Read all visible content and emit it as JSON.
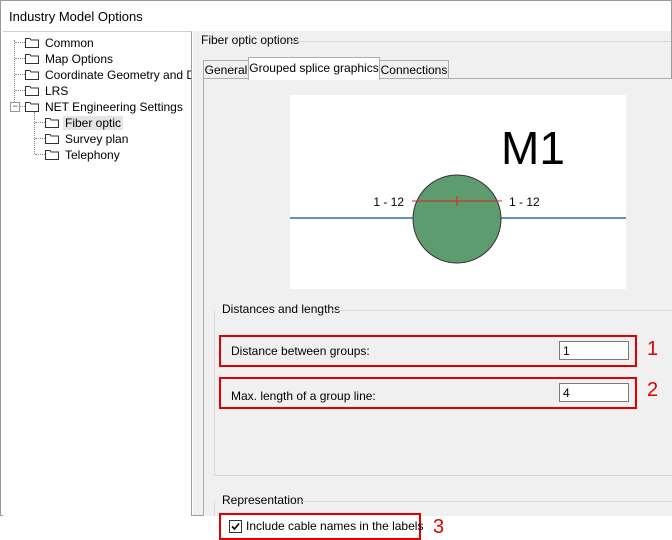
{
  "window": {
    "title": "Industry Model Options"
  },
  "tree": {
    "items": [
      {
        "label": "Common"
      },
      {
        "label": "Map Options"
      },
      {
        "label": "Coordinate Geometry and Dime"
      },
      {
        "label": "LRS"
      },
      {
        "label": "NET Engineering Settings"
      },
      {
        "label": "Fiber optic"
      },
      {
        "label": "Survey plan"
      },
      {
        "label": "Telephony"
      }
    ]
  },
  "panel": {
    "title": "Fiber optic options",
    "tabs": [
      "General",
      "Grouped splice graphics",
      "Connections"
    ],
    "preview": {
      "label": "M1",
      "left_text": "1 - 12",
      "right_text": "1 - 12",
      "circle_color": "#5e9b6f",
      "line_color": "#2f6f9f",
      "tick_color": "#e02020"
    },
    "distances": {
      "title": "Distances and lengths",
      "distance_label": "Distance between groups:",
      "distance_value": "1",
      "maxlength_label": "Max. length of a group line:",
      "maxlength_value": "4"
    },
    "representation": {
      "title": "Representation",
      "include_label": "Include cable names in the labels",
      "include_checked": true
    }
  },
  "callouts": [
    "1",
    "2",
    "3"
  ],
  "colors": {
    "highlight": "#e00000"
  }
}
